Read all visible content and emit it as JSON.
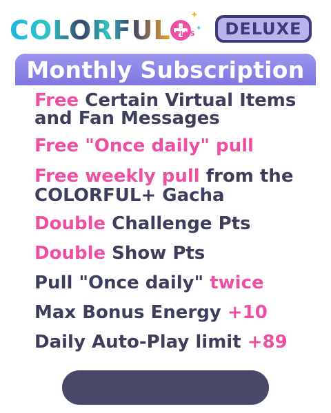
{
  "logo": {
    "wordmark": "COLORFUL",
    "plus_label": "PLUS",
    "badge_label": "DELUXE"
  },
  "header": {
    "title": "Monthly Subscription"
  },
  "benefits": [
    {
      "hl": "Free",
      "rest": " Certain Virtual Items and Fan Messages"
    },
    {
      "hl": "Free \"Once daily\" pull",
      "rest": ""
    },
    {
      "hl": "Free weekly pull",
      "rest": " from the COLORFUL+ Gacha"
    },
    {
      "hl": "Double",
      "rest": " Challenge Pts"
    },
    {
      "hl": "Double",
      "rest": " Show Pts"
    },
    {
      "pre": "Pull \"Once daily\" ",
      "hl_end": "twice"
    },
    {
      "pre": "Max Bonus Energy ",
      "hl_end": "+10"
    },
    {
      "pre": "Daily Auto-Play limit ",
      "hl_end": "+89"
    }
  ],
  "colors": {
    "accent_pink": "#ee4fa3",
    "text_dark": "#3d3d5c",
    "header_purple": "#8b84e8",
    "button_dark": "#474868"
  }
}
